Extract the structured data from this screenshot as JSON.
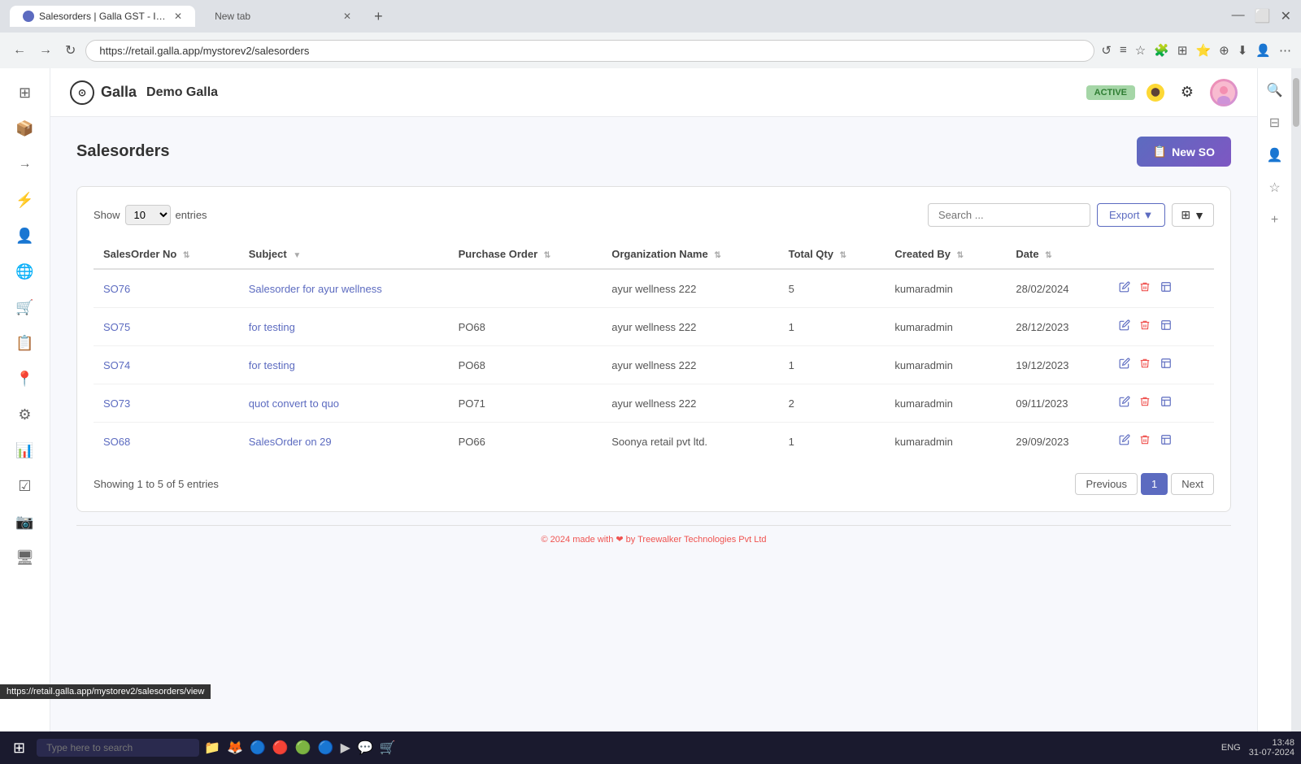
{
  "browser": {
    "tabs": [
      {
        "label": "Salesorders | Galla GST - Invento...",
        "active": true,
        "url": "https://retail.galla.app/mystorev2/salesorders"
      },
      {
        "label": "New tab",
        "active": false,
        "url": ""
      }
    ],
    "address": "https://retail.galla.app/mystorev2/salesorders",
    "tooltip_url": "https://retail.galla.app/mystorev2/salesorders/view"
  },
  "topbar": {
    "logo_text": "Galla",
    "store_name": "Demo Galla",
    "active_badge": "ACTIVE",
    "settings_icon": "⚙",
    "user_initials": "👤"
  },
  "page": {
    "title": "Salesorders",
    "new_so_label": "New SO"
  },
  "table_controls": {
    "show_label": "Show",
    "show_value": "10",
    "entries_label": "entries",
    "search_placeholder": "Search ...",
    "export_label": "Export"
  },
  "table": {
    "columns": [
      {
        "key": "salesorder_no",
        "label": "SalesOrder No",
        "sortable": true
      },
      {
        "key": "subject",
        "label": "Subject",
        "sortable": true
      },
      {
        "key": "purchase_order",
        "label": "Purchase Order",
        "sortable": true
      },
      {
        "key": "org_name",
        "label": "Organization Name",
        "sortable": true
      },
      {
        "key": "total_qty",
        "label": "Total Qty",
        "sortable": true
      },
      {
        "key": "created_by",
        "label": "Created By",
        "sortable": true
      },
      {
        "key": "date",
        "label": "Date",
        "sortable": true
      }
    ],
    "rows": [
      {
        "id": 1,
        "salesorder_no": "SO76",
        "subject": "Salesorder for ayur wellness",
        "purchase_order": "",
        "org_name": "ayur wellness 222",
        "total_qty": "5",
        "created_by": "kumaradmin",
        "date": "28/02/2024"
      },
      {
        "id": 2,
        "salesorder_no": "SO75",
        "subject": "for testing",
        "purchase_order": "PO68",
        "org_name": "ayur wellness 222",
        "total_qty": "1",
        "created_by": "kumaradmin",
        "date": "28/12/2023"
      },
      {
        "id": 3,
        "salesorder_no": "SO74",
        "subject": "for testing",
        "purchase_order": "PO68",
        "org_name": "ayur wellness 222",
        "total_qty": "1",
        "created_by": "kumaradmin",
        "date": "19/12/2023"
      },
      {
        "id": 4,
        "salesorder_no": "SO73",
        "subject": "quot convert to quo",
        "purchase_order": "PO71",
        "org_name": "ayur wellness 222",
        "total_qty": "2",
        "created_by": "kumaradmin",
        "date": "09/11/2023"
      },
      {
        "id": 5,
        "salesorder_no": "SO68",
        "subject": "SalesOrder on 29",
        "purchase_order": "PO66",
        "org_name": "Soonya retail pvt ltd.",
        "total_qty": "1",
        "created_by": "kumaradmin",
        "date": "29/09/2023"
      }
    ]
  },
  "pagination": {
    "showing_text": "Showing 1 to 5 of 5 entries",
    "previous_label": "Previous",
    "next_label": "Next",
    "current_page": "1"
  },
  "footer": {
    "text": "© 2024 made with ❤ by Treewalker Technologies Pvt Ltd"
  },
  "taskbar": {
    "search_placeholder": "Type here to search",
    "time": "13:48",
    "date": "31-07-2024",
    "lang": "ENG"
  },
  "sidebar": {
    "icons": [
      "⊞",
      "📦",
      "→",
      "⚡",
      "👤",
      "🌐",
      "🛒",
      "📋",
      "📍",
      "⚙",
      "📊",
      "☑",
      "📷",
      "🖥"
    ]
  }
}
